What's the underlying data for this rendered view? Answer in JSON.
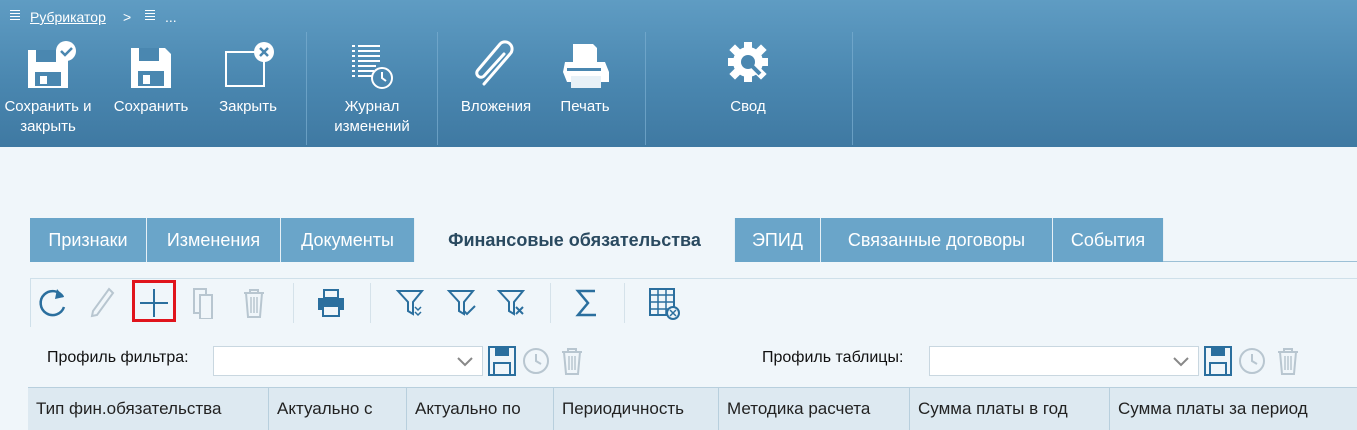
{
  "breadcrumb": {
    "root": "Рубрикатор",
    "separator": ">",
    "current": "..."
  },
  "ribbon": {
    "save_close": "Сохранить и закрыть",
    "save": "Сохранить",
    "close": "Закрыть",
    "changelog": "Журнал изменений",
    "attachments": "Вложения",
    "print": "Печать",
    "summary": "Свод"
  },
  "tabs": [
    "Признаки",
    "Изменения",
    "Документы",
    "Финансовые обязательства",
    "ЭПИД",
    "Связанные договоры",
    "События"
  ],
  "filter_profile": {
    "label": "Профиль фильтра:",
    "value": ""
  },
  "table_profile": {
    "label": "Профиль таблицы:",
    "value": ""
  },
  "columns": [
    "Тип фин.обязательства",
    "Актуально с",
    "Актуально по",
    "Периодичность",
    "Методика расчета",
    "Сумма платы в год",
    "Сумма платы за период"
  ],
  "colors": {
    "ribbon": "#4a87b0",
    "tab": "#6aa5c9",
    "highlight": "#e0141c",
    "icon": "#2b6f9e"
  }
}
